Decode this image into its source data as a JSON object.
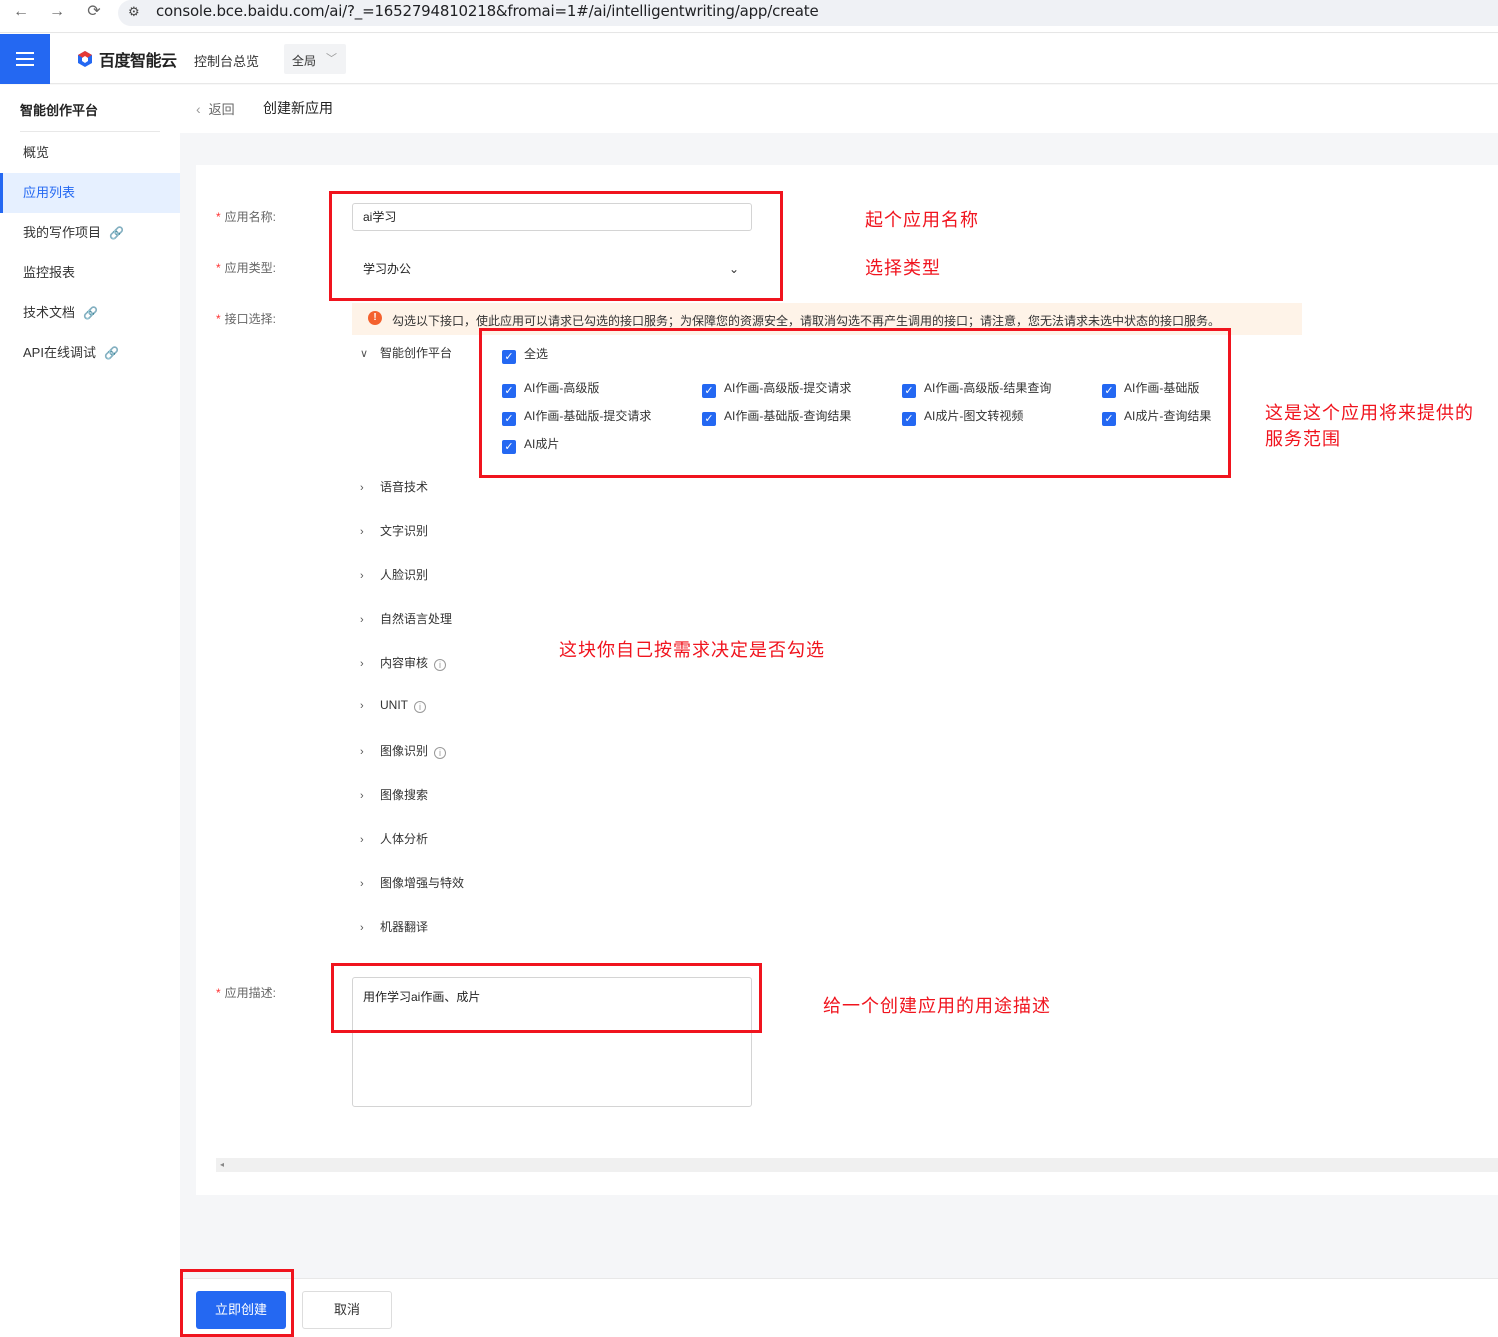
{
  "browser": {
    "back": "←",
    "forward": "→",
    "reload": "⟳",
    "url": "console.bce.baidu.com/ai/?_=1652794810218&fromai=1#/ai/intelligentwriting/app/create"
  },
  "header": {
    "logo_text": "百度智能云",
    "console_link": "控制台总览",
    "region": "全局"
  },
  "sidebar": {
    "title": "智能创作平台",
    "items": [
      {
        "label": "概览",
        "active": false,
        "external": false
      },
      {
        "label": "应用列表",
        "active": true,
        "external": false
      },
      {
        "label": "我的写作项目",
        "active": false,
        "external": true
      },
      {
        "label": "监控报表",
        "active": false,
        "external": false
      },
      {
        "label": "技术文档",
        "active": false,
        "external": true
      },
      {
        "label": "API在线调试",
        "active": false,
        "external": true
      }
    ]
  },
  "breadcrumb": {
    "back": "返回",
    "title": "创建新应用"
  },
  "form": {
    "name_label": "应用名称:",
    "name_value": "ai学习",
    "type_label": "应用类型:",
    "type_value": "学习办公",
    "api_label": "接口选择:",
    "notice": "勾选以下接口，使此应用可以请求已勾选的接口服务；为保障您的资源安全，请取消勾选不再产生调用的接口；请注意，您无法请求未选中状态的接口服务。",
    "expanded_group": "智能创作平台",
    "select_all": "全选",
    "apis": [
      "AI作画-高级版",
      "AI作画-高级版-提交请求",
      "AI作画-高级版-结果查询",
      "AI作画-基础版",
      "AI作画-基础版-提交请求",
      "AI作画-基础版-查询结果",
      "AI成片-图文转视频",
      "AI成片-查询结果",
      "AI成片"
    ],
    "groups": [
      {
        "label": "语音技术",
        "info": false
      },
      {
        "label": "文字识别",
        "info": false
      },
      {
        "label": "人脸识别",
        "info": false
      },
      {
        "label": "自然语言处理",
        "info": false
      },
      {
        "label": "内容审核",
        "info": true
      },
      {
        "label": "UNIT",
        "info": true
      },
      {
        "label": "图像识别",
        "info": true
      },
      {
        "label": "图像搜索",
        "info": false
      },
      {
        "label": "人体分析",
        "info": false
      },
      {
        "label": "图像增强与特效",
        "info": false
      },
      {
        "label": "机器翻译",
        "info": false
      }
    ],
    "desc_label": "应用描述:",
    "desc_value": "用作学习ai作画、成片"
  },
  "footer": {
    "create": "立即创建",
    "cancel": "取消"
  },
  "annotations": {
    "name": "起个应用名称",
    "type": "选择类型",
    "scope_line1": "这是这个应用将来提供的",
    "scope_line2": "服务范围",
    "choose": "这块你自己按需求决定是否勾选",
    "desc": "给一个创建应用的用途描述"
  },
  "colors": {
    "primary": "#2468f2",
    "annotation": "#f0141e",
    "notice_bg": "#fef3e8",
    "warn": "#f4612e"
  }
}
